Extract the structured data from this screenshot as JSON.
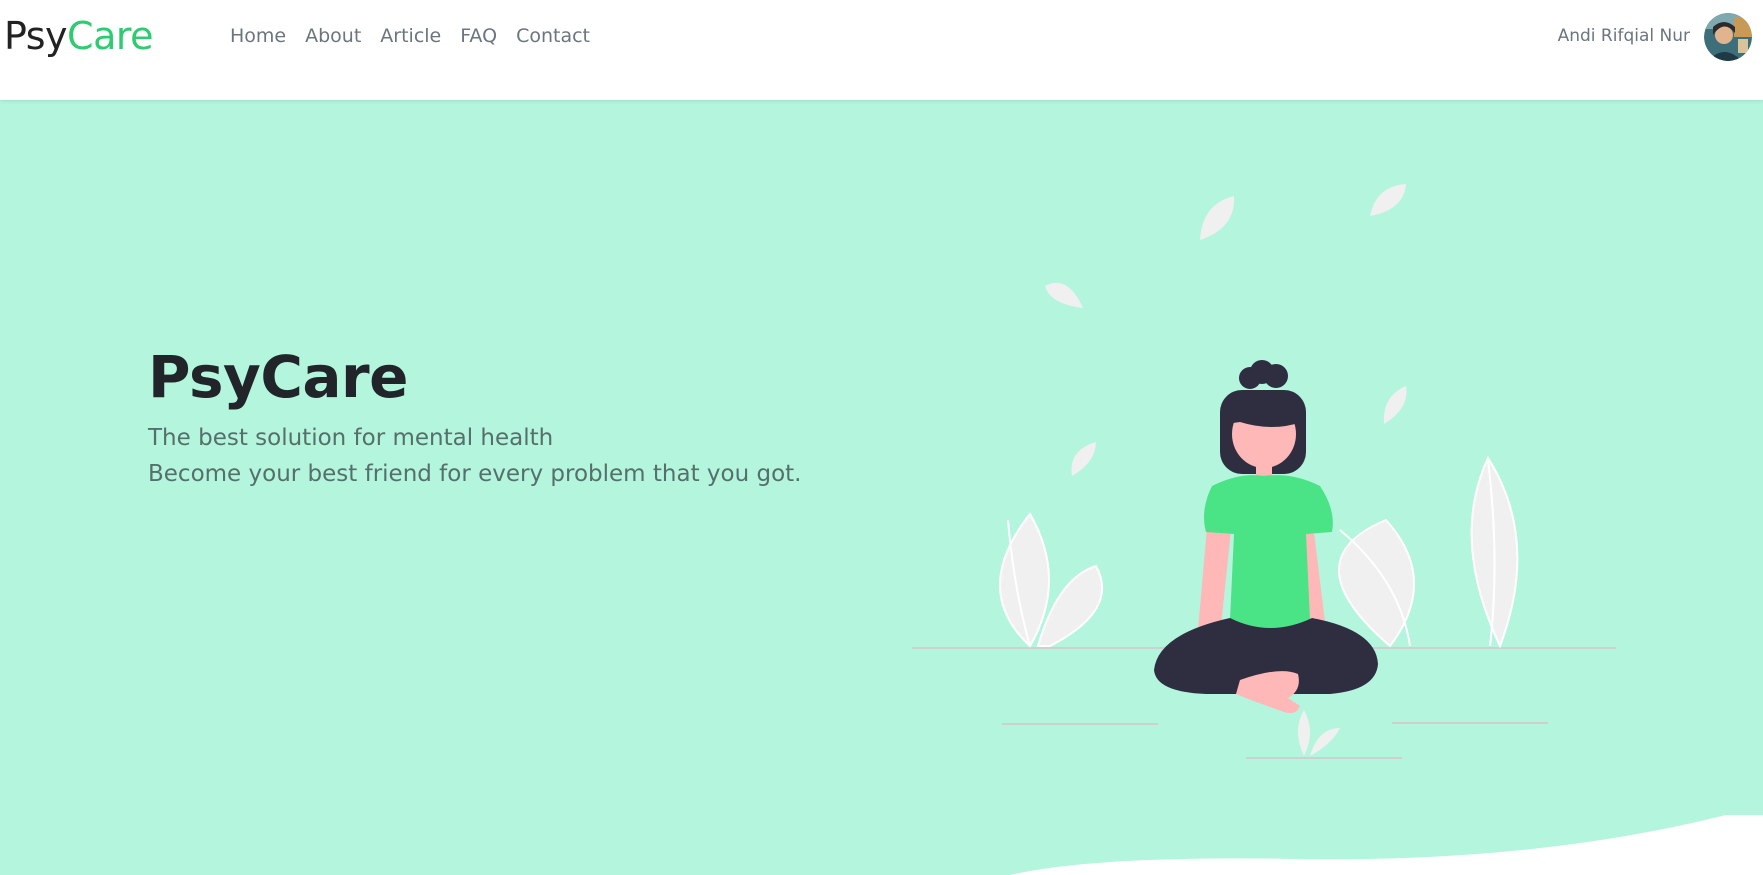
{
  "navbar": {
    "brand_part1": "Psy",
    "brand_part2": "Care",
    "links": [
      {
        "label": "Home"
      },
      {
        "label": "About"
      },
      {
        "label": "Article"
      },
      {
        "label": "FAQ"
      },
      {
        "label": "Contact"
      }
    ],
    "user_name": "Andi Rifqial Nur"
  },
  "hero": {
    "title": "PsyCare",
    "subtitle_line1": "The best solution for mental health",
    "subtitle_line2": "Become your best friend for every problem that you got."
  },
  "colors": {
    "accent": "#2ecc71",
    "hero_background": "#b4f5de",
    "shirt": "#4ae385",
    "hair_and_pants": "#2f2e41",
    "skin": "#ffb8b8",
    "leaves": "#f0f0f0"
  },
  "icons": {
    "avatar": "user-avatar-photo"
  }
}
